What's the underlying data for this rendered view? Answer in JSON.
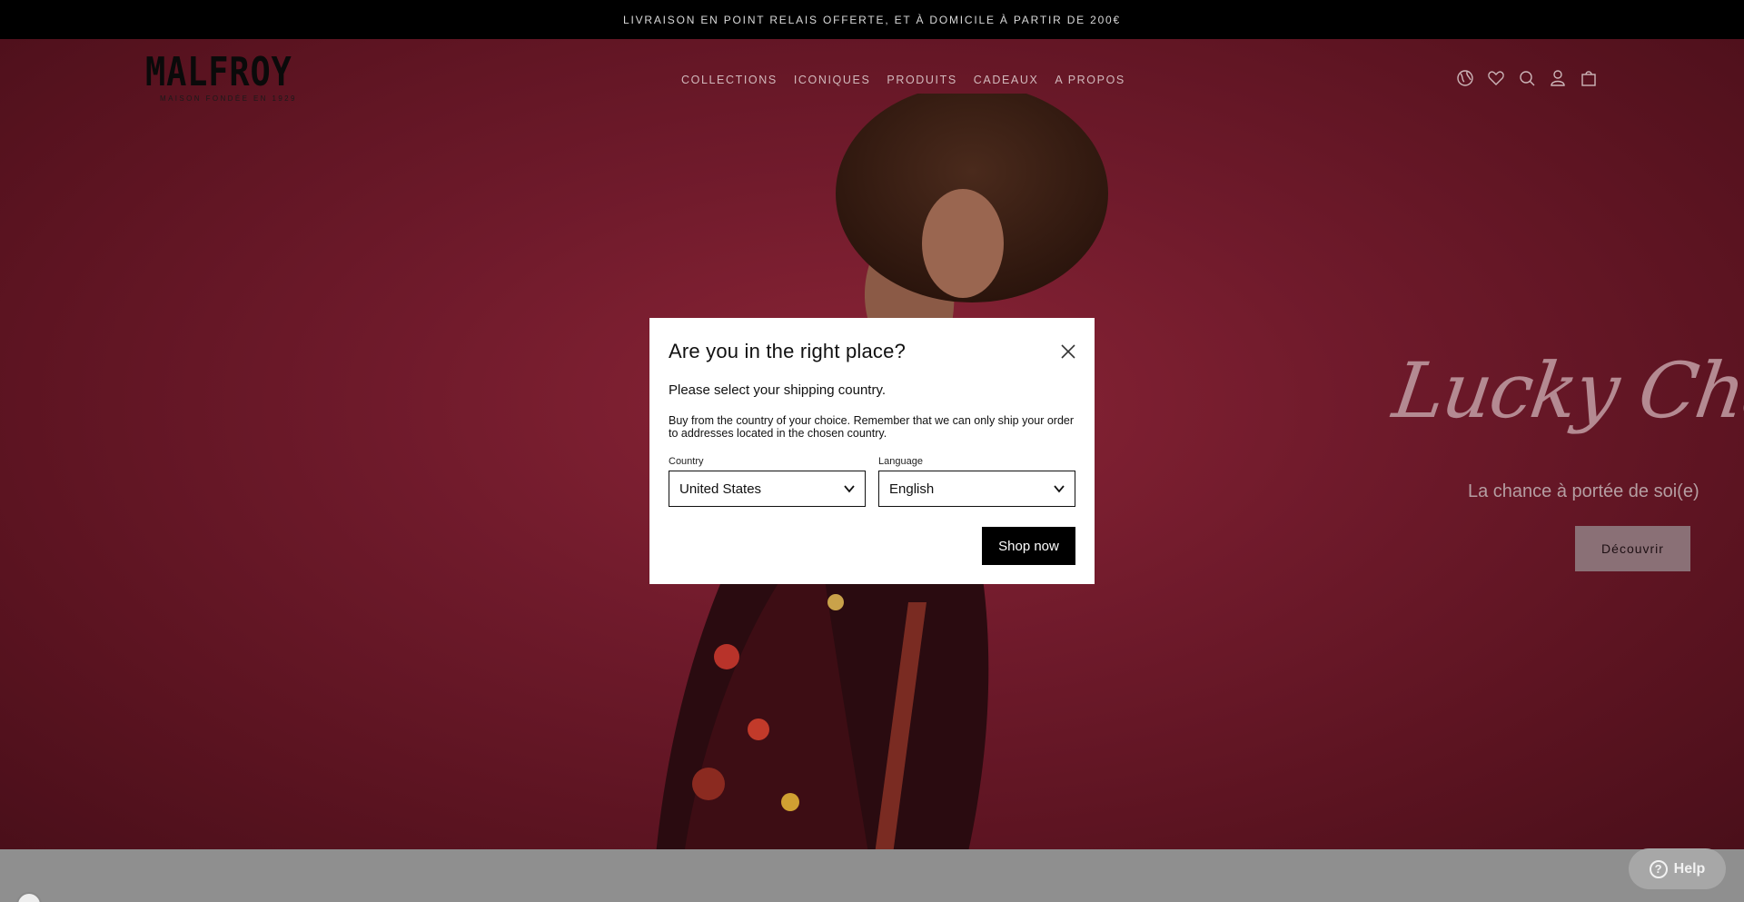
{
  "announcement": "LIVRAISON EN POINT RELAIS OFFERTE, ET À DOMICILE À PARTIR DE 200€",
  "brand": {
    "name": "MALFROY",
    "tagline": "MAISON FONDÉE EN 1929"
  },
  "nav": [
    "COLLECTIONS",
    "ICONIQUES",
    "PRODUITS",
    "CADEAUX",
    "A PROPOS"
  ],
  "header_icons": [
    "globe-icon",
    "heart-icon",
    "search-icon",
    "user-icon",
    "bag-icon"
  ],
  "hero": {
    "title": "Lucky Charms",
    "subtitle": "La chance à portée de soi(e)",
    "cta": "Découvrir"
  },
  "modal": {
    "title": "Are you in the right place?",
    "subtitle": "Please select your shipping country.",
    "description": "Buy from the country of your choice. Remember that we can only ship your order to addresses located in the chosen country.",
    "country_label": "Country",
    "country_value": "United States",
    "language_label": "Language",
    "language_value": "English",
    "cta": "Shop now"
  },
  "help": {
    "label": "Help"
  },
  "colors": {
    "hero_bg": "#6f1a2b",
    "announcement_bg": "#000000",
    "cta_bg": "#000000"
  }
}
